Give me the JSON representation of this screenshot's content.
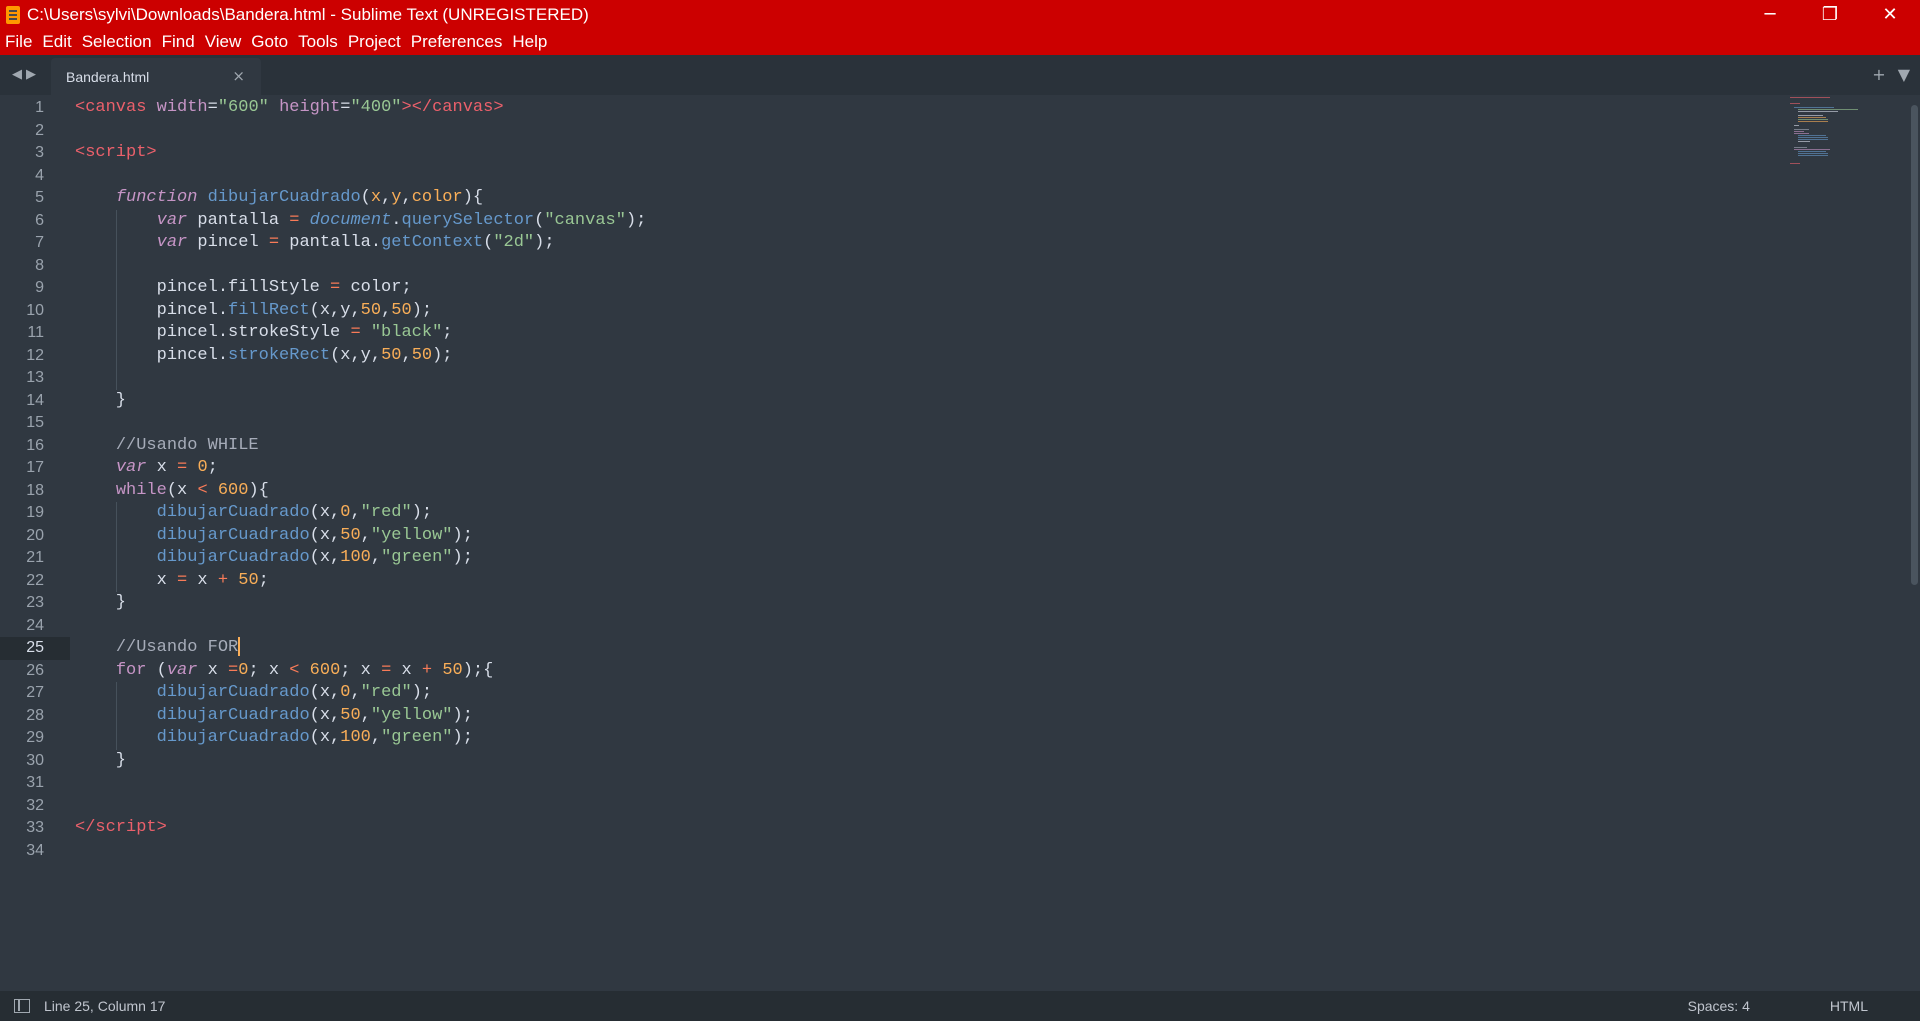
{
  "window": {
    "title": "C:\\Users\\sylvi\\Downloads\\Bandera.html - Sublime Text (UNREGISTERED)",
    "minimize_icon": "─",
    "restore_icon": "❐",
    "close_icon": "✕",
    "accent": "#cc0000"
  },
  "menu": {
    "items": [
      "File",
      "Edit",
      "Selection",
      "Find",
      "View",
      "Goto",
      "Tools",
      "Project",
      "Preferences",
      "Help"
    ]
  },
  "tabs": {
    "nav_back": "◀",
    "nav_forward": "▶",
    "active_tab": "Bandera.html",
    "close": "×",
    "new_tab": "+",
    "tab_menu": "▼"
  },
  "editor": {
    "current_line": 25,
    "line_numbers": [
      "1",
      "2",
      "3",
      "4",
      "5",
      "6",
      "7",
      "8",
      "9",
      "10",
      "11",
      "12",
      "13",
      "14",
      "15",
      "16",
      "17",
      "18",
      "19",
      "20",
      "21",
      "22",
      "23",
      "24",
      "25",
      "26",
      "27",
      "28",
      "29",
      "30",
      "31",
      "32",
      "33",
      "34"
    ]
  },
  "status": {
    "position": "Line 25, Column 17",
    "indentation": "Spaces: 4",
    "syntax": "HTML"
  }
}
